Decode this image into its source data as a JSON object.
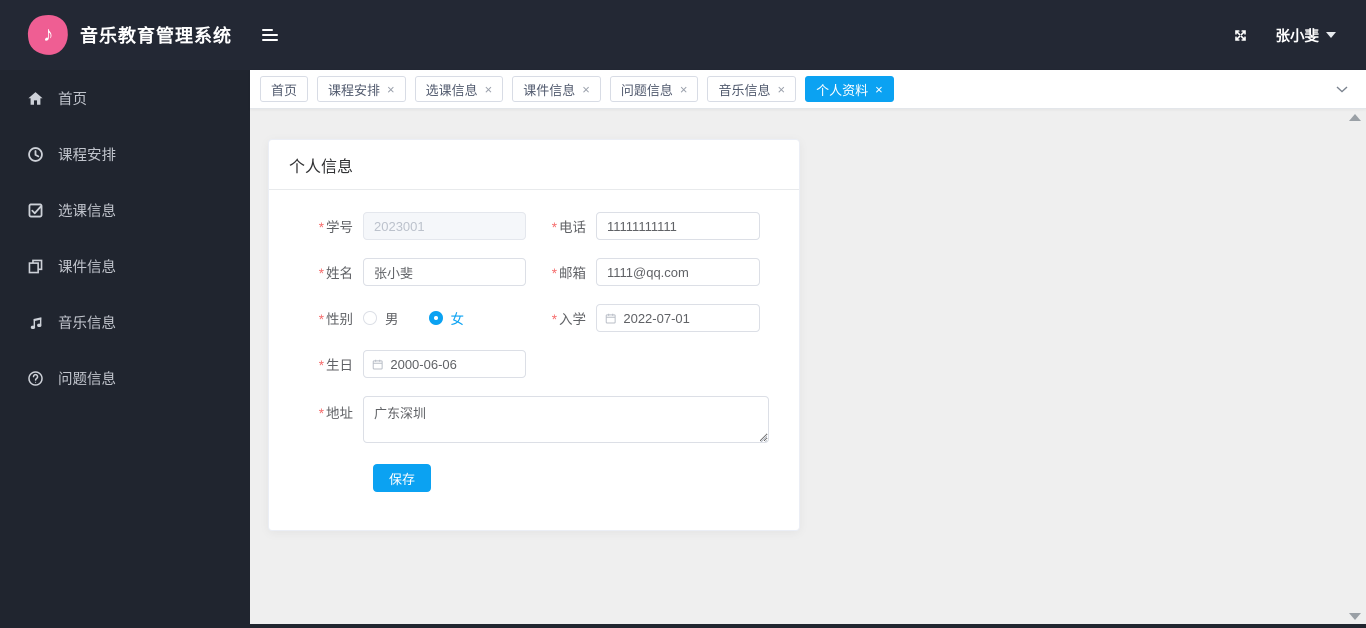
{
  "colors": {
    "accent": "#0ba2f2",
    "header_bg": "#232834",
    "sidebar_bg": "#20252f",
    "content_bg": "#efefef",
    "logo_pink": "#ef5e93",
    "required_red": "#f56c6c"
  },
  "header": {
    "title": "音乐教育管理系统",
    "user_name": "张小斐",
    "icons": [
      "music-note-logo",
      "hamburger-icon",
      "fullscreen-icon",
      "caret-down-icon"
    ]
  },
  "sidebar": {
    "items": [
      {
        "icon": "home-icon",
        "label": "首页"
      },
      {
        "icon": "clock-icon",
        "label": "课程安排"
      },
      {
        "icon": "check-square-icon",
        "label": "选课信息"
      },
      {
        "icon": "copy-icon",
        "label": "课件信息"
      },
      {
        "icon": "music-note-icon",
        "label": "音乐信息"
      },
      {
        "icon": "question-circle-icon",
        "label": "问题信息"
      }
    ]
  },
  "tabbar": {
    "close_glyph": "×",
    "tabs": [
      {
        "label": "首页",
        "closable": false,
        "active": false
      },
      {
        "label": "课程安排",
        "closable": true,
        "active": false
      },
      {
        "label": "选课信息",
        "closable": true,
        "active": false
      },
      {
        "label": "课件信息",
        "closable": true,
        "active": false
      },
      {
        "label": "问题信息",
        "closable": true,
        "active": false
      },
      {
        "label": "音乐信息",
        "closable": true,
        "active": false
      },
      {
        "label": "个人资料",
        "closable": true,
        "active": true
      }
    ]
  },
  "panel": {
    "title": "个人信息",
    "save_label": "保存",
    "fields": {
      "student_id": {
        "label": "学号",
        "value": "2023001",
        "disabled": true
      },
      "phone": {
        "label": "电话",
        "value": "11111111111"
      },
      "name": {
        "label": "姓名",
        "value": "张小斐"
      },
      "email": {
        "label": "邮箱",
        "value": "1111@qq.com"
      },
      "gender": {
        "label": "性别",
        "options": [
          "男",
          "女"
        ],
        "selected": "女"
      },
      "enroll": {
        "label": "入学",
        "value": "2022-07-01"
      },
      "birthday": {
        "label": "生日",
        "value": "2000-06-06"
      },
      "address": {
        "label": "地址",
        "value": "广东深圳"
      }
    }
  }
}
